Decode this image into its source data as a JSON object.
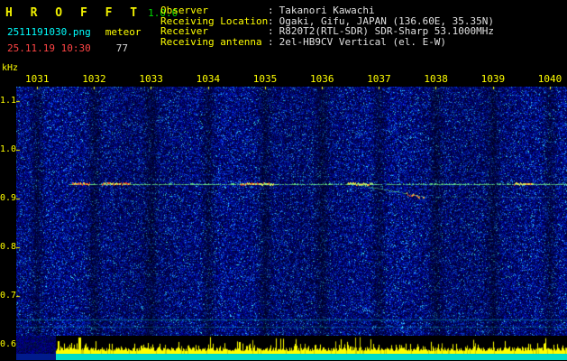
{
  "header": {
    "title": "H R O F F T",
    "version": "1.0.0",
    "filename": "2511191030.png",
    "mode": "meteor",
    "timestamp": "25.11.19 10:30",
    "count": "77",
    "info_rows": [
      {
        "label": "Observer",
        "value": "Takanori Kawachi"
      },
      {
        "label": "Receiving Location",
        "value": "Ogaki, Gifu, JAPAN (136.60E, 35.35N)"
      },
      {
        "label": "Receiver",
        "value": "R820T2(RTL-SDR) SDR-Sharp 53.1000MHz"
      },
      {
        "label": "Receiving antenna",
        "value": "2el-HB9CV Vertical (el. E-W)"
      }
    ]
  },
  "spectrogram": {
    "unit_label": "kHz",
    "time_ticks": [
      "1031",
      "1032",
      "1033",
      "1034",
      "1035",
      "1036",
      "1037",
      "1038",
      "1039",
      "1040"
    ],
    "freq_ticks": [
      "1.1",
      "1.0",
      "0.9",
      "0.8",
      "0.7",
      "0.6"
    ],
    "carrier_freq_khz": 0.93,
    "colors": {
      "noise_blue": "#0000c8",
      "carrier_green": "#6ef58c",
      "hot_red": "#ff3c1e",
      "hot_yellow": "#ffe646",
      "power_yellow": "#ffff00",
      "marker_cyan": "#00ddc8",
      "axis_yellow": "#ffff00"
    }
  }
}
